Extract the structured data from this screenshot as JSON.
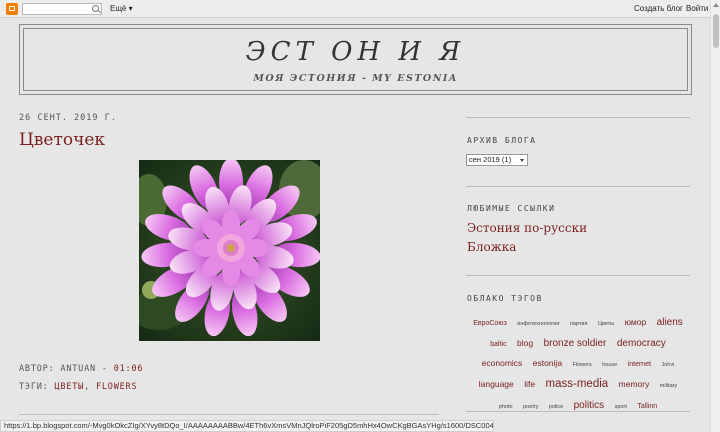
{
  "navbar": {
    "more_label": "Ещё ▾",
    "create_blog": "Создать блог",
    "login": "Войти"
  },
  "header": {
    "title": "ЭСТ ОН И Я",
    "description": "МОЯ ЭСТОНИЯ - MY ESTONIA"
  },
  "post": {
    "date": "26 СЕНТ. 2019 Г.",
    "title": "Цветочек",
    "author_label": "АВТОР: ANTUAN - ",
    "time": "01:06",
    "tags_label": "ТЭГИ: ",
    "tags": [
      "ЦВЕТЫ",
      "FLOWERS"
    ],
    "tag_separator": ", "
  },
  "sidebar": {
    "archive_heading": "АРХИВ БЛОГА",
    "archive_selected": "сен 2019 (1)",
    "links_heading": "ЛЮБИМЫЕ ССЫЛКИ",
    "links": [
      "Эстония по-русски",
      "Бложка"
    ],
    "cloud_heading": "ОБЛАКО ТЭГОВ",
    "cloud": [
      {
        "tag": "ЕвроСоюз",
        "size": 2
      },
      {
        "tag": "инфотехнологии",
        "size": 1
      },
      {
        "tag": "партия",
        "size": 1
      },
      {
        "tag": "Цветы",
        "size": 1
      },
      {
        "tag": "юмор",
        "size": 3
      },
      {
        "tag": "aliens",
        "size": 4
      },
      {
        "tag": "baltic",
        "size": 2
      },
      {
        "tag": "blog",
        "size": 3
      },
      {
        "tag": "bronze soldier",
        "size": 4
      },
      {
        "tag": "democracy",
        "size": 4
      },
      {
        "tag": "economics",
        "size": 3
      },
      {
        "tag": "estonija",
        "size": 3
      },
      {
        "tag": "Flowers",
        "size": 1
      },
      {
        "tag": "house",
        "size": 1
      },
      {
        "tag": "internet",
        "size": 2
      },
      {
        "tag": "Johvi",
        "size": 1
      },
      {
        "tag": "language",
        "size": 3
      },
      {
        "tag": "life",
        "size": 3
      },
      {
        "tag": "mass-media",
        "size": 5
      },
      {
        "tag": "memory",
        "size": 3
      },
      {
        "tag": "military",
        "size": 1
      },
      {
        "tag": "photo",
        "size": 1
      },
      {
        "tag": "poetry",
        "size": 1
      },
      {
        "tag": "police",
        "size": 1
      },
      {
        "tag": "politics",
        "size": 4
      },
      {
        "tag": "sport",
        "size": 1
      },
      {
        "tag": "Tallinn",
        "size": 2
      }
    ]
  },
  "statusbar": {
    "url": "https://1.bp.blogspot.com/-Mvg0kOkcZIg/XYvy8tDQo_I/AAAAAAAABBw/4ETh6vXmsVMnJQlroPiF205gD5mhHx4OwCKgBGAsYHg/s1600/DSC00486_Optimizer6.jpg"
  },
  "colors": {
    "link": "#7a1f1f",
    "page_bg": "#e6e6e6",
    "blogger_orange": "#f57d00"
  },
  "icons": [
    "blogger-logo-icon",
    "search-icon",
    "chevron-down-icon"
  ]
}
